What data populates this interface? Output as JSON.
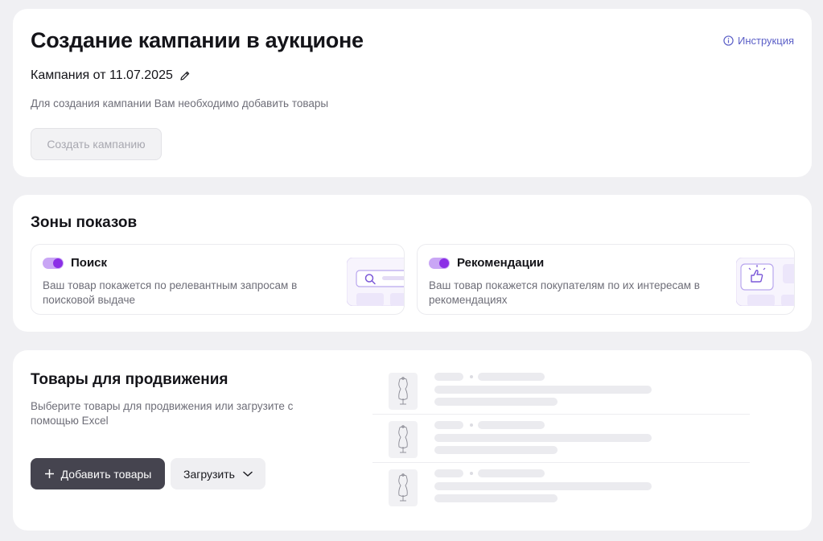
{
  "create": {
    "title": "Создание кампании в аукционе",
    "instruction_link": "Инструкция",
    "campaign_name": "Кампания от 11.07.2025",
    "hint": "Для создания кампании Вам необходимо добавить товары",
    "create_button": "Создать кампанию"
  },
  "zones": {
    "title": "Зоны показов",
    "items": [
      {
        "title": "Поиск",
        "description": "Ваш товар покажется по релевантным запросам в поисковой выдаче",
        "enabled": true,
        "icon": "search-illustration"
      },
      {
        "title": "Рекомендации",
        "description": "Ваш товар покажется покупателям по их интересам в рекомендациях",
        "enabled": true,
        "icon": "thumbs-up-illustration"
      }
    ]
  },
  "products": {
    "title": "Товары для продвижения",
    "description": "Выберите товары для продвижения или загрузите с помощью Excel",
    "add_button": "Добавить товары",
    "upload_button": "Загрузить"
  },
  "colors": {
    "accent": "#8b2fe6",
    "link": "#5b5fc7",
    "primary_button": "#45444f"
  }
}
